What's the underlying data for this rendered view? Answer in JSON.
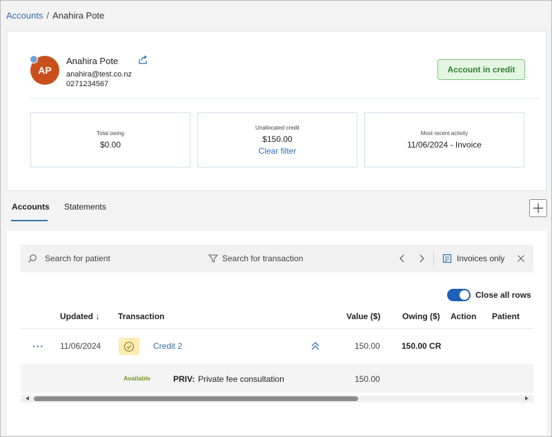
{
  "breadcrumb": {
    "parent": "Accounts",
    "separator": "/",
    "current": "Anahira Pote"
  },
  "patient": {
    "initials": "AP",
    "name": "Anahira Pote",
    "email": "anahira@test.co.nz",
    "phone": "0271234567",
    "avatar_color": "#c9501c"
  },
  "status_badge": "Account in credit",
  "stats": {
    "total_owing": {
      "label": "Total owing",
      "value": "$0.00"
    },
    "unallocated_credit": {
      "label": "Unallocated credit",
      "value": "$150.00",
      "link": "Clear filter"
    },
    "recent_activity": {
      "label": "Most recent activity",
      "value": "11/06/2024 - Invoice"
    }
  },
  "tabs": [
    {
      "label": "Accounts",
      "active": true
    },
    {
      "label": "Statements",
      "active": false
    }
  ],
  "toolbar": {
    "patient_placeholder": "Search for patient",
    "transaction_placeholder": "Search for transaction",
    "invoices_only": "Invoices only"
  },
  "toggle": {
    "label": "Close all rows",
    "on": true
  },
  "table": {
    "columns": {
      "updated": "Updated ↓",
      "transaction": "Transaction",
      "value": "Value ($)",
      "owing": "Owing ($)",
      "action": "Action",
      "patient": "Patient"
    },
    "rows": [
      {
        "menu": "···",
        "updated": "11/06/2024",
        "transaction": "Credit 2",
        "value": "150.00",
        "owing": "150.00 CR",
        "detail": {
          "status": "Available",
          "code": "PRIV:",
          "description": "Private fee consultation",
          "value": "150.00"
        }
      }
    ]
  },
  "colors": {
    "accent": "#2f6fb0",
    "badge_bg": "#e4f5e2",
    "badge_text": "#2f7d32",
    "toggle": "#1f5fb5"
  }
}
